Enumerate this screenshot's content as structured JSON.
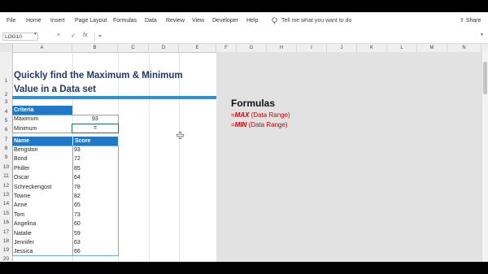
{
  "ribbon": {
    "tabs": [
      "File",
      "Home",
      "Insert",
      "Page Layout",
      "Formulas",
      "Data",
      "Review",
      "View",
      "Developer",
      "Help"
    ],
    "tell_me": "Tell me what you want to do",
    "share": "Share"
  },
  "formula_bar": {
    "name_box": "LOG10",
    "cancel": "×",
    "enter": "✓",
    "fx": "fx",
    "content": "="
  },
  "columns": [
    "A",
    "B",
    "C",
    "D",
    "E",
    "F",
    "G",
    "H",
    "I",
    "J",
    "K",
    "L",
    "M",
    "N"
  ],
  "rows": [
    "1",
    "2",
    "3",
    "4",
    "5",
    "6",
    "7",
    "8",
    "9",
    "10",
    "11",
    "12",
    "13",
    "14",
    "15",
    "16",
    "17",
    "18",
    "19",
    "20"
  ],
  "sheet": {
    "title_line1": "Quickly find the Maximum & Minimum",
    "title_line2": "Value in a Data set",
    "criteria_header": "Criteria",
    "maximum_label": "Maximum",
    "maximum_value": "93",
    "minimum_label": "Minimum",
    "minimum_value": "=",
    "name_header": "Name",
    "score_header": "Score",
    "records": [
      {
        "name": "Bengston",
        "score": "93"
      },
      {
        "name": "Bond",
        "score": "72"
      },
      {
        "name": "Philler",
        "score": "85"
      },
      {
        "name": "Oscar",
        "score": "64"
      },
      {
        "name": "Schreckengost",
        "score": "78"
      },
      {
        "name": "Towne",
        "score": "82"
      },
      {
        "name": "Anne",
        "score": "65"
      },
      {
        "name": "Tom",
        "score": "73"
      },
      {
        "name": "Angelina",
        "score": "60"
      },
      {
        "name": "Natalie",
        "score": "59"
      },
      {
        "name": "Jennifer",
        "score": "63"
      },
      {
        "name": "Jessica",
        "score": "66"
      }
    ]
  },
  "formulas_panel": {
    "title": "Formulas",
    "items": [
      {
        "prefix": "=",
        "func": "MAX",
        "arg": " (Data Range)"
      },
      {
        "prefix": "=",
        "func": "MIN",
        "arg": " (Data Range)"
      }
    ]
  },
  "colors": {
    "accent": "#1f78c8",
    "excel_green": "#217346",
    "formula_red": "#cc0000"
  }
}
